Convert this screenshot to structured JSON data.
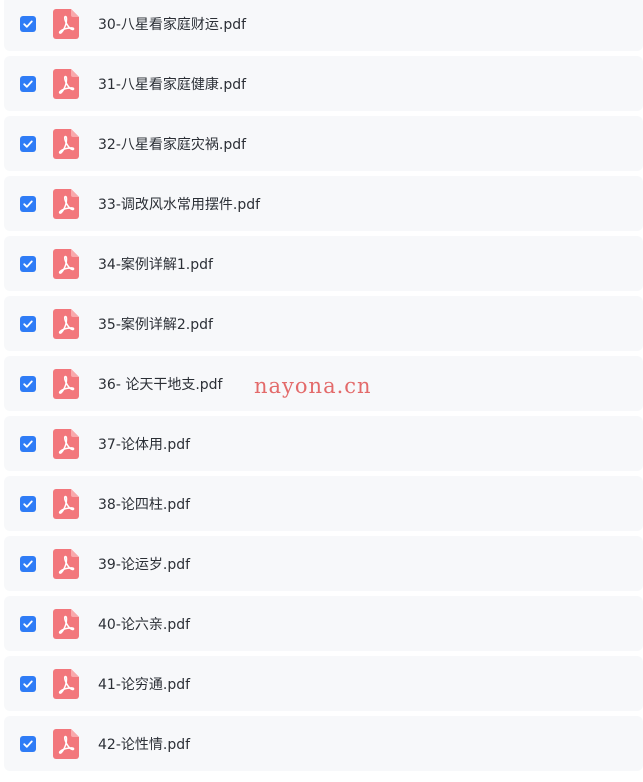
{
  "files": [
    {
      "name": "30-八星看家庭财运.pdf",
      "checked": true
    },
    {
      "name": "31-八星看家庭健康.pdf",
      "checked": true
    },
    {
      "name": "32-八星看家庭灾祸.pdf",
      "checked": true
    },
    {
      "name": "33-调改风水常用摆件.pdf",
      "checked": true
    },
    {
      "name": "34-案例详解1.pdf",
      "checked": true
    },
    {
      "name": "35-案例详解2.pdf",
      "checked": true
    },
    {
      "name": "36- 论天干地支.pdf",
      "checked": true
    },
    {
      "name": "37-论体用.pdf",
      "checked": true
    },
    {
      "name": "38-论四柱.pdf",
      "checked": true
    },
    {
      "name": "39-论运岁.pdf",
      "checked": true
    },
    {
      "name": "40-论六亲.pdf",
      "checked": true
    },
    {
      "name": "41-论穷通.pdf",
      "checked": true
    },
    {
      "name": "42-论性情.pdf",
      "checked": true
    }
  ],
  "watermark": "nayona.cn",
  "icons": {
    "file": "pdf-file-icon",
    "checkbox": "check-icon"
  },
  "colors": {
    "checkbox": "#2f7cf6",
    "pdf_icon": "#f2777c",
    "row_background": "#f7f8fa",
    "watermark": "#e36a6a"
  }
}
